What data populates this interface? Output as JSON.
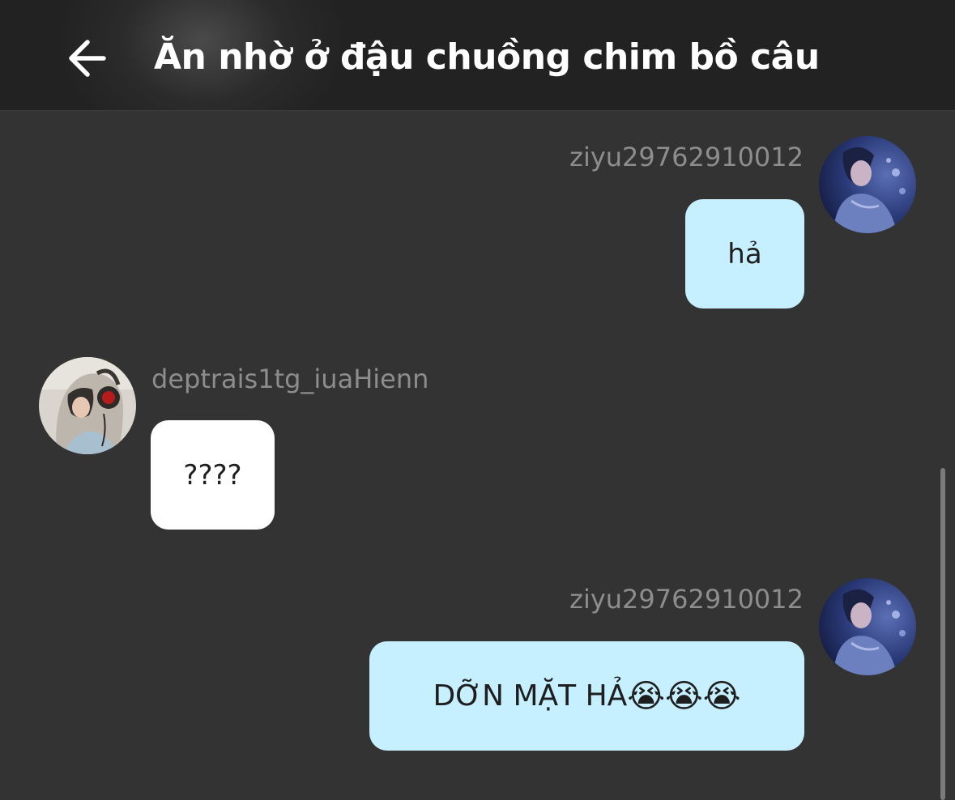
{
  "header": {
    "title": "Ăn nhờ ở đậu chuồng chim bồ câu",
    "back_icon": "arrow-left-icon"
  },
  "messages": [
    {
      "sender": "ziyu29762910012",
      "text": "hả",
      "side": "right"
    },
    {
      "sender": "deptrais1tg_iuaHienn",
      "text": "????",
      "side": "left"
    },
    {
      "sender": "ziyu29762910012",
      "text": "DỠN MẶT HẢ",
      "emoji": "😭😭😭",
      "side": "right"
    }
  ],
  "colors": {
    "background": "#333333",
    "header": "#222222",
    "bubble_mine": "#c6efff",
    "bubble_theirs": "#ffffff",
    "username": "#8d8d8d"
  }
}
